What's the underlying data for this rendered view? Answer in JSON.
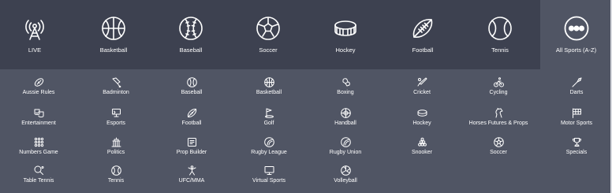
{
  "top_nav": [
    {
      "label": "LIVE",
      "icon": "live-tower-icon"
    },
    {
      "label": "Basketball",
      "icon": "basketball-icon"
    },
    {
      "label": "Baseball",
      "icon": "baseball-icon"
    },
    {
      "label": "Soccer",
      "icon": "soccer-ball-icon"
    },
    {
      "label": "Hockey",
      "icon": "hockey-puck-icon"
    },
    {
      "label": "Football",
      "icon": "football-icon"
    },
    {
      "label": "Tennis",
      "icon": "tennis-ball-icon"
    },
    {
      "label": "All Sports (A-Z)",
      "icon": "more-dots-icon"
    }
  ],
  "sports_grid": [
    [
      {
        "label": "Aussie Rules",
        "icon": "aussie-rules-icon"
      },
      {
        "label": "Badminton",
        "icon": "badminton-icon"
      },
      {
        "label": "Baseball",
        "icon": "baseball-icon"
      },
      {
        "label": "Basketball",
        "icon": "basketball-icon"
      },
      {
        "label": "Boxing",
        "icon": "boxing-icon"
      },
      {
        "label": "Cricket",
        "icon": "cricket-icon"
      },
      {
        "label": "Cycling",
        "icon": "cycling-icon"
      },
      {
        "label": "Darts",
        "icon": "darts-icon"
      }
    ],
    [
      {
        "label": "Entertainment",
        "icon": "entertainment-icon"
      },
      {
        "label": "Esports",
        "icon": "esports-icon"
      },
      {
        "label": "Football",
        "icon": "football-icon"
      },
      {
        "label": "Golf",
        "icon": "golf-icon"
      },
      {
        "label": "Handball",
        "icon": "handball-icon"
      },
      {
        "label": "Hockey",
        "icon": "hockey-icon"
      },
      {
        "label": "Horses Futures & Props",
        "icon": "horse-icon"
      },
      {
        "label": "Motor Sports",
        "icon": "motor-sports-flag-icon"
      }
    ],
    [
      {
        "label": "Numbers Game",
        "icon": "numbers-game-icon"
      },
      {
        "label": "Politics",
        "icon": "politics-icon"
      },
      {
        "label": "Prop Builder",
        "icon": "prop-builder-icon"
      },
      {
        "label": "Rugby League",
        "icon": "rugby-league-icon"
      },
      {
        "label": "Rugby Union",
        "icon": "rugby-union-icon"
      },
      {
        "label": "Snooker",
        "icon": "snooker-icon"
      },
      {
        "label": "Soccer",
        "icon": "soccer-icon"
      },
      {
        "label": "Specials",
        "icon": "specials-trophy-icon"
      }
    ],
    [
      {
        "label": "Table Tennis",
        "icon": "table-tennis-icon"
      },
      {
        "label": "Tennis",
        "icon": "tennis-icon"
      },
      {
        "label": "UFC/MMA",
        "icon": "ufc-mma-icon"
      },
      {
        "label": "Virtual Sports",
        "icon": "virtual-sports-icon"
      },
      {
        "label": "Volleyball",
        "icon": "volleyball-icon"
      }
    ]
  ],
  "colors": {
    "top_bar": "#3d4150",
    "panel": "#505564",
    "text": "#ffffff"
  }
}
